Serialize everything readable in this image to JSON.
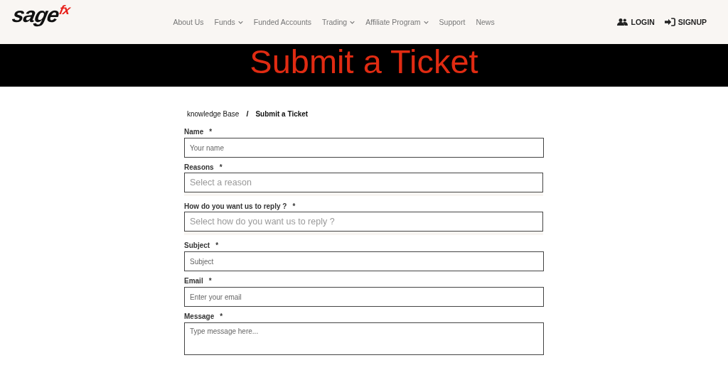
{
  "logo": {
    "main": "sage",
    "accent": "fx"
  },
  "nav": [
    {
      "label": "About Us",
      "dropdown": false
    },
    {
      "label": "Funds",
      "dropdown": true
    },
    {
      "label": "Funded Accounts",
      "dropdown": false
    },
    {
      "label": "Trading",
      "dropdown": true
    },
    {
      "label": "Affiliate Program",
      "dropdown": true
    },
    {
      "label": "Support",
      "dropdown": false
    },
    {
      "label": "News",
      "dropdown": false
    }
  ],
  "account_links": [
    {
      "label": "LOGIN",
      "kind": "login"
    },
    {
      "label": "SIGNUP",
      "kind": "signup"
    }
  ],
  "hero": {
    "title": "Submit a Ticket"
  },
  "breadcrumb": [
    {
      "label": "knowledge Base",
      "current": false
    },
    {
      "label": "Submit a Ticket",
      "current": true
    }
  ],
  "breadcrumb_separator": "/",
  "form": {
    "fields": [
      {
        "label": "Name",
        "required_mark": "*",
        "kind": "text",
        "placeholder": "Your name"
      },
      {
        "label": "Reasons",
        "required_mark": "*",
        "kind": "select",
        "placeholder": "Select a reason"
      },
      {
        "label": "How do you want us to reply ?",
        "required_mark": "*",
        "kind": "select",
        "placeholder": "Select how do you want us to reply ?"
      },
      {
        "label": "Subject",
        "required_mark": "*",
        "kind": "text",
        "placeholder": "Subject"
      },
      {
        "label": "Email",
        "required_mark": "*",
        "kind": "text",
        "placeholder": "Enter your email"
      },
      {
        "label": "Message",
        "required_mark": "*",
        "kind": "textarea",
        "placeholder": "Type message here..."
      }
    ]
  }
}
